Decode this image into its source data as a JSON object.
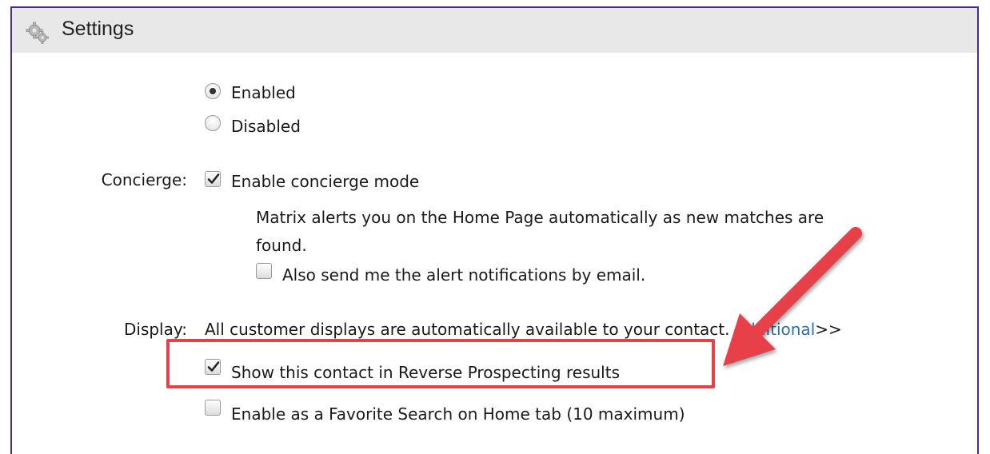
{
  "header": {
    "title": "Settings",
    "icon": "gear-icon"
  },
  "status": {
    "options": [
      {
        "label": "Enabled",
        "selected": true
      },
      {
        "label": "Disabled",
        "selected": false
      }
    ]
  },
  "concierge": {
    "label": "Concierge:",
    "enable_label": "Enable concierge mode",
    "enable_checked": true,
    "description_line1": "Matrix alerts you on the Home Page automatically as new matches are",
    "description_line2": "found.",
    "email_label": "Also send me the alert notifications by email.",
    "email_checked": false
  },
  "display": {
    "label": "Display:",
    "text": "All customer displays are automatically available to your contact.",
    "link_text": "Additional",
    "link_suffix": ">>",
    "reverse_label": "Show this contact in Reverse Prospecting results",
    "reverse_checked": true,
    "favorite_label": "Enable as a Favorite Search on Home tab (10 maximum)",
    "favorite_checked": false
  },
  "annotation": {
    "color": "#e8404a"
  }
}
